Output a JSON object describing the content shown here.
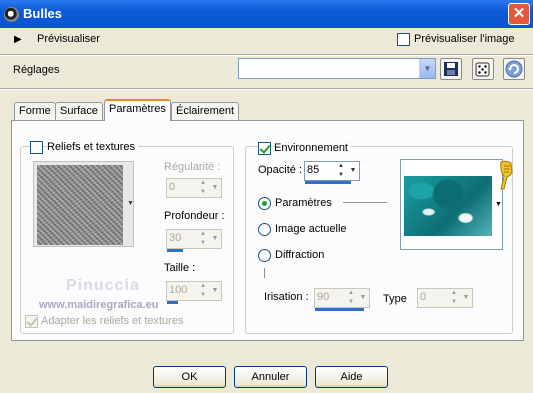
{
  "window": {
    "title": "Bulles",
    "close_glyph": "✕"
  },
  "preview": {
    "label": "Prévisualiser",
    "preview_image_label": "Prévisualiser l'image",
    "preview_image_checked": false
  },
  "presets": {
    "label": "Réglages",
    "value": "",
    "icons": [
      "save-icon",
      "dice-icon",
      "reset-icon"
    ]
  },
  "tabs": [
    {
      "label": "Forme"
    },
    {
      "label": "Surface"
    },
    {
      "label": "Paramètres",
      "active": true
    },
    {
      "label": "Éclairement"
    }
  ],
  "left_group": {
    "textures_label": "Reliefs et textures",
    "textures_checked": false,
    "regularity": {
      "label": "Régularité :",
      "value": "0"
    },
    "depth": {
      "label": "Profondeur :",
      "value": "30",
      "level": 0.3
    },
    "size": {
      "label": "Taille :",
      "value": "100",
      "level": 0.2
    },
    "adapt_label": "Adapter les reliefs et textures",
    "adapt_checked": true
  },
  "right_group": {
    "environment_label": "Environnement",
    "environment_checked": true,
    "opacity": {
      "label": "Opacité :",
      "value": "85",
      "level": 0.85
    },
    "radios": [
      {
        "label": "Paramètres",
        "selected": true
      },
      {
        "label": "Image actuelle",
        "selected": false
      },
      {
        "label": "Diffraction",
        "selected": false
      }
    ],
    "iridescence": {
      "label": "Irisation :",
      "value": "90",
      "level": 0.9
    },
    "type": {
      "label": "Type",
      "value": "0"
    }
  },
  "watermark": {
    "name": "Pinuccia",
    "url": "www.maidiregrafica.eu"
  },
  "buttons": {
    "ok": "OK",
    "cancel": "Annuler",
    "help": "Aide"
  },
  "colors": {
    "titlebar": "#0a55d2",
    "check": "#21a121",
    "active_tab": "#e68b2c"
  }
}
